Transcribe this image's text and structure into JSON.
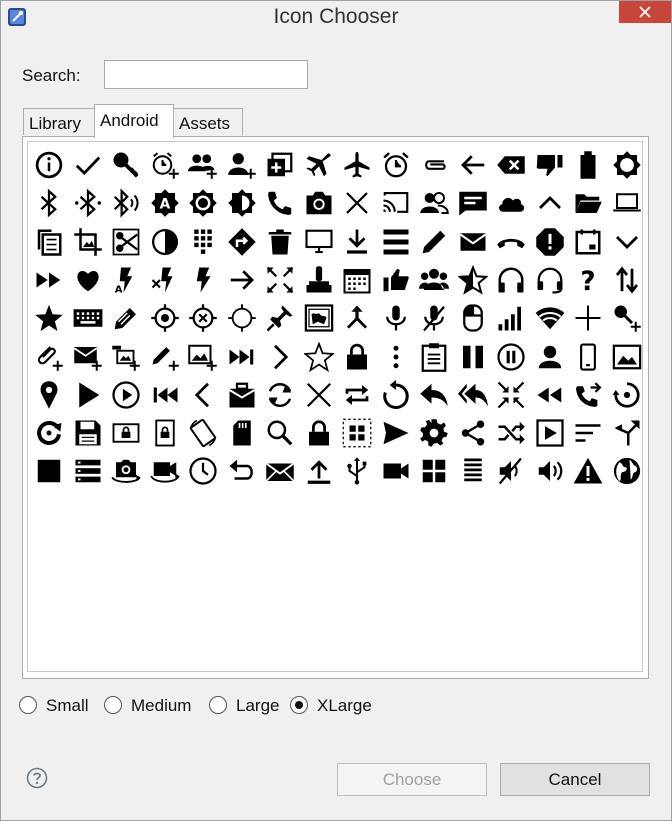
{
  "window": {
    "title": "Icon Chooser",
    "close_color": "#c7453b"
  },
  "search": {
    "label": "Search:",
    "value": "",
    "placeholder": ""
  },
  "tabs": [
    {
      "label": "Library",
      "active": false
    },
    {
      "label": "Android",
      "active": true
    },
    {
      "label": "Assets",
      "active": false
    }
  ],
  "icons": [
    "info-icon",
    "check-icon",
    "key-icon",
    "alarm-add-icon",
    "group-add-icon",
    "person-add-icon",
    "add-to-queue-icon",
    "airplane-icon",
    "airplane-mode-icon",
    "alarm-icon",
    "attachment-icon",
    "back-arrow-icon",
    "backspace-icon",
    "thumb-down-icon",
    "battery-icon",
    "brightness-icon",
    "bluetooth-icon",
    "bluetooth-connected-icon",
    "bluetooth-audio-icon",
    "brightness-auto-icon",
    "brightness-high-icon",
    "brightness-medium-icon",
    "phone-icon",
    "camera-icon",
    "close-icon",
    "cast-icon",
    "people-icon",
    "chat-icon",
    "cloud-icon",
    "chevron-up-icon",
    "folder-open-icon",
    "laptop-icon",
    "copy-icon",
    "crop-icon",
    "cut-icon",
    "data-usage-icon",
    "dialpad-icon",
    "directions-icon",
    "delete-icon",
    "desktop-icon",
    "download-icon",
    "drag-handle-icon",
    "edit-icon",
    "email-icon",
    "end-call-icon",
    "error-icon",
    "event-icon",
    "chevron-down-icon",
    "fast-forward-icon",
    "favorite-icon",
    "flash-auto-icon",
    "flash-off-icon",
    "flash-icon",
    "forward-arrow-icon",
    "fullscreen-icon",
    "gamepad-icon",
    "calendar-grid-icon",
    "thumb-up-icon",
    "group-icon",
    "star-half-icon",
    "headphones-icon",
    "headset-mic-icon",
    "help-icon",
    "import-export-icon",
    "star-icon",
    "keyboard-icon",
    "label-icon",
    "location-searching-icon",
    "location-disabled-icon",
    "location-crosshair-icon",
    "pin-icon",
    "map-icon",
    "merge-icon",
    "mic-icon",
    "mic-off-icon",
    "mouse-icon",
    "network-signal-icon",
    "wifi-icon",
    "add-icon",
    "key-add-icon",
    "attach-add-icon",
    "email-add-icon",
    "image-add-alt-icon",
    "edit-add-icon",
    "image-add-icon",
    "skip-next-icon",
    "chevron-right-icon",
    "star-outline-icon",
    "lock-icon",
    "more-vertical-icon",
    "clipboard-icon",
    "pause-icon",
    "pause-circle-icon",
    "person-icon",
    "smartphone-icon",
    "image-icon",
    "place-icon",
    "play-icon",
    "play-circle-icon",
    "skip-previous-icon",
    "chevron-left-icon",
    "inbox-icon",
    "refresh-icon",
    "close-thin-icon",
    "repeat-icon",
    "replay-icon",
    "reply-icon",
    "reply-all-icon",
    "collapse-icon",
    "rewind-icon",
    "phone-forward-icon",
    "restore-icon",
    "sync-icon",
    "save-icon",
    "screen-lock-landscape-icon",
    "screen-lock-portrait-icon",
    "screen-rotation-icon",
    "sd-card-icon",
    "search-icon",
    "lock-closed-icon",
    "select-all-icon",
    "send-icon",
    "settings-icon",
    "share-icon",
    "shuffle-icon",
    "slideshow-icon",
    "sort-icon",
    "call-split-icon",
    "stop-icon",
    "storage-icon",
    "switch-camera-icon",
    "switch-video-icon",
    "clock-icon",
    "undo-icon",
    "unread-mail-icon",
    "upload-icon",
    "usb-icon",
    "video-camera-icon",
    "view-module-icon",
    "view-list-icon",
    "volume-off-icon",
    "volume-up-icon",
    "warning-icon",
    "globe-icon"
  ],
  "sizes": [
    {
      "label": "Small",
      "checked": false
    },
    {
      "label": "Medium",
      "checked": false
    },
    {
      "label": "Large",
      "checked": false
    },
    {
      "label": "XLarge",
      "checked": true
    }
  ],
  "buttons": {
    "choose_label": "Choose",
    "cancel_label": "Cancel"
  }
}
